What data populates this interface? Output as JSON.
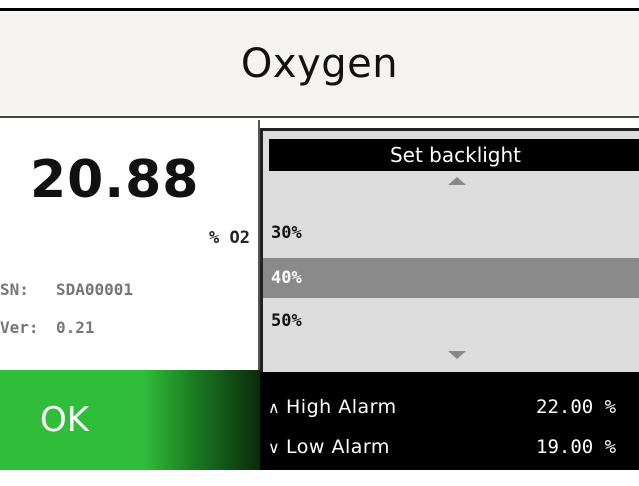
{
  "header": {
    "title": "Oxygen"
  },
  "reading": {
    "value": "20.88",
    "unit": "% O2",
    "serial_label": "SN:",
    "serial_value": "SDA00001",
    "version_label": "Ver:",
    "version_value": "0.21"
  },
  "ok_button": {
    "label": "OK"
  },
  "backlight_menu": {
    "title": "Set backlight",
    "options": [
      "30%",
      "40%",
      "50%"
    ],
    "selected": "40%"
  },
  "alarms": {
    "high": {
      "label": "High Alarm",
      "value": "22.00 %",
      "icon": "chevron-up"
    },
    "low": {
      "label": "Low Alarm",
      "value": "19.00 %",
      "icon": "chevron-down"
    }
  },
  "colors": {
    "ok_green": "#2fbd3a",
    "selected_row": "#8a8a8a",
    "popup_bg": "#dcdcdc"
  }
}
